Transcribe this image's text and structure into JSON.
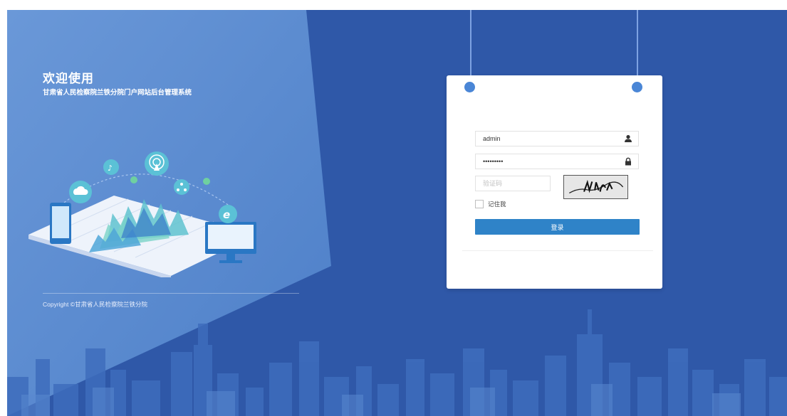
{
  "welcome": {
    "title": "欢迎使用",
    "subtitle": "甘肃省人民检察院兰铁分院门户网站后台管理系统"
  },
  "footer": {
    "copyright": "Copyright ©甘肃省人民检察院兰铁分院"
  },
  "login": {
    "username": "admin",
    "password": "•••••••••",
    "captcha_placeholder": "验证码",
    "remember_label": "记住我",
    "remember_checked": false,
    "login_button": "登录"
  },
  "icons": {
    "username": "user-icon",
    "password": "lock-icon",
    "illustration": [
      "cloud-icon",
      "music-icon",
      "broadcast-icon",
      "network-icon",
      "ie-icon",
      "phone-icon",
      "monitor-icon"
    ]
  },
  "colors": {
    "background": "#2f58a8",
    "left_panel": "#5e8fd1",
    "login_button": "#2f83c8",
    "pin": "#4a86d6"
  }
}
